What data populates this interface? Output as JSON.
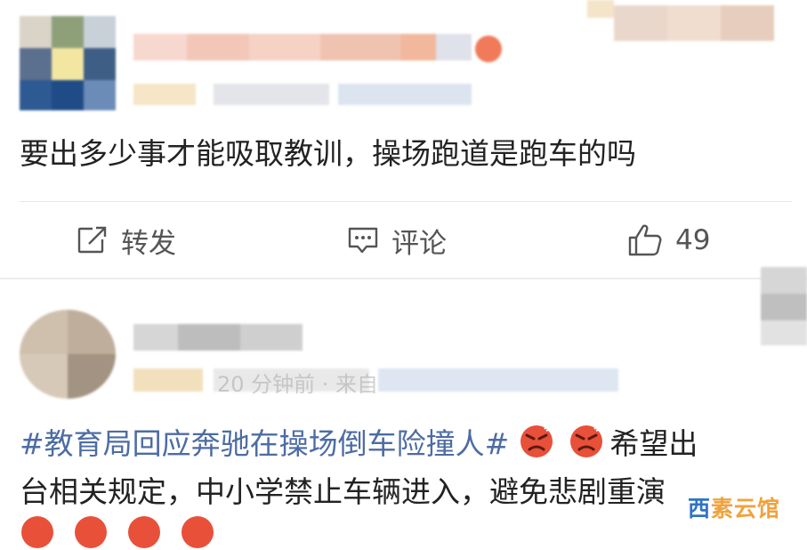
{
  "post1": {
    "content": "要出多少事才能吸取教训，操场跑道是跑车的吗",
    "actions": {
      "repost_label": "转发",
      "comment_label": "评论",
      "like_count": "49"
    }
  },
  "post2": {
    "meta_visible": "20 分钟前 · 来自",
    "hashtag": "#教育局回应奔驰在操场倒车险撞人#",
    "text_after_emoji": "希望出",
    "line2": "台相关规定，中小学禁止车辆进入，避免悲剧重演"
  },
  "watermark": {
    "part1": "西",
    "part2": "素云馆"
  },
  "colors": {
    "hashtag": "#4d6ca3",
    "text": "#222222",
    "action": "#555555"
  },
  "icons": [
    "repost-icon",
    "comment-icon",
    "like-icon",
    "angry-emoji-icon"
  ]
}
